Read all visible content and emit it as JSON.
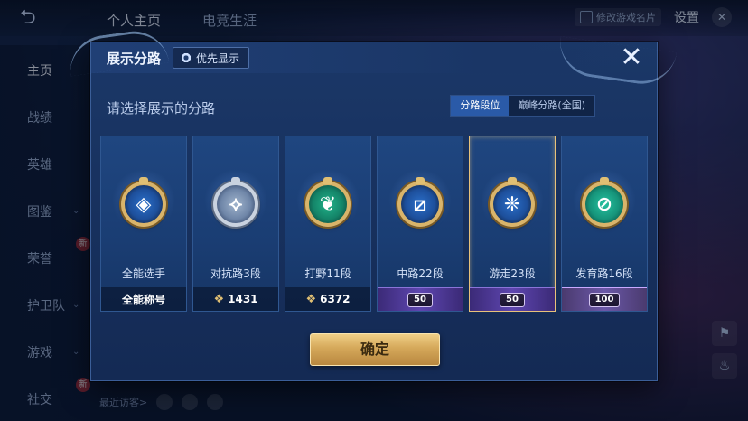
{
  "topbar": {
    "tabs": [
      "个人主页",
      "电竞生涯"
    ],
    "name_card_label": "修改游戏名片",
    "settings_label": "设置"
  },
  "sidebar": {
    "items": [
      {
        "label": "主页",
        "active": true
      },
      {
        "label": "战绩"
      },
      {
        "label": "英雄"
      },
      {
        "label": "图鉴",
        "chevron": true
      },
      {
        "label": "荣誉",
        "badge": "新"
      },
      {
        "label": "护卫队",
        "chevron": true
      },
      {
        "label": "游戏",
        "chevron": true
      },
      {
        "label": "社交",
        "badge": "新"
      }
    ]
  },
  "bottom": {
    "recent_visitors": "最近访客>"
  },
  "modal": {
    "title": "展示分路",
    "priority_label": "优先显示",
    "close_symbol": "✕",
    "subtitle": "请选择展示的分路",
    "segments": [
      {
        "label": "分路段位",
        "active": true
      },
      {
        "label": "巅峰分路(全国)",
        "active": false
      }
    ],
    "cards": [
      {
        "label": "全能选手",
        "foot_text": "全能称号",
        "foot_type": "text",
        "emblem": "blue",
        "selected": false
      },
      {
        "label": "对抗路3段",
        "foot_text": "1431",
        "foot_type": "points",
        "emblem": "silver",
        "selected": false
      },
      {
        "label": "打野11段",
        "foot_text": "6372",
        "foot_type": "points",
        "emblem": "green",
        "selected": false
      },
      {
        "label": "中路22段",
        "foot_text": "50",
        "foot_type": "level",
        "emblem": "blue",
        "selected": false
      },
      {
        "label": "游走23段",
        "foot_text": "50",
        "foot_type": "level",
        "emblem": "blue",
        "selected": true
      },
      {
        "label": "发育路16段",
        "foot_text": "100",
        "foot_type": "level",
        "emblem": "teal",
        "selected": false
      }
    ],
    "confirm_label": "确定"
  },
  "colors": {
    "accent_gold": "#d5a85a",
    "panel_blue": "#183260",
    "selected_border": "#e8c27a"
  }
}
